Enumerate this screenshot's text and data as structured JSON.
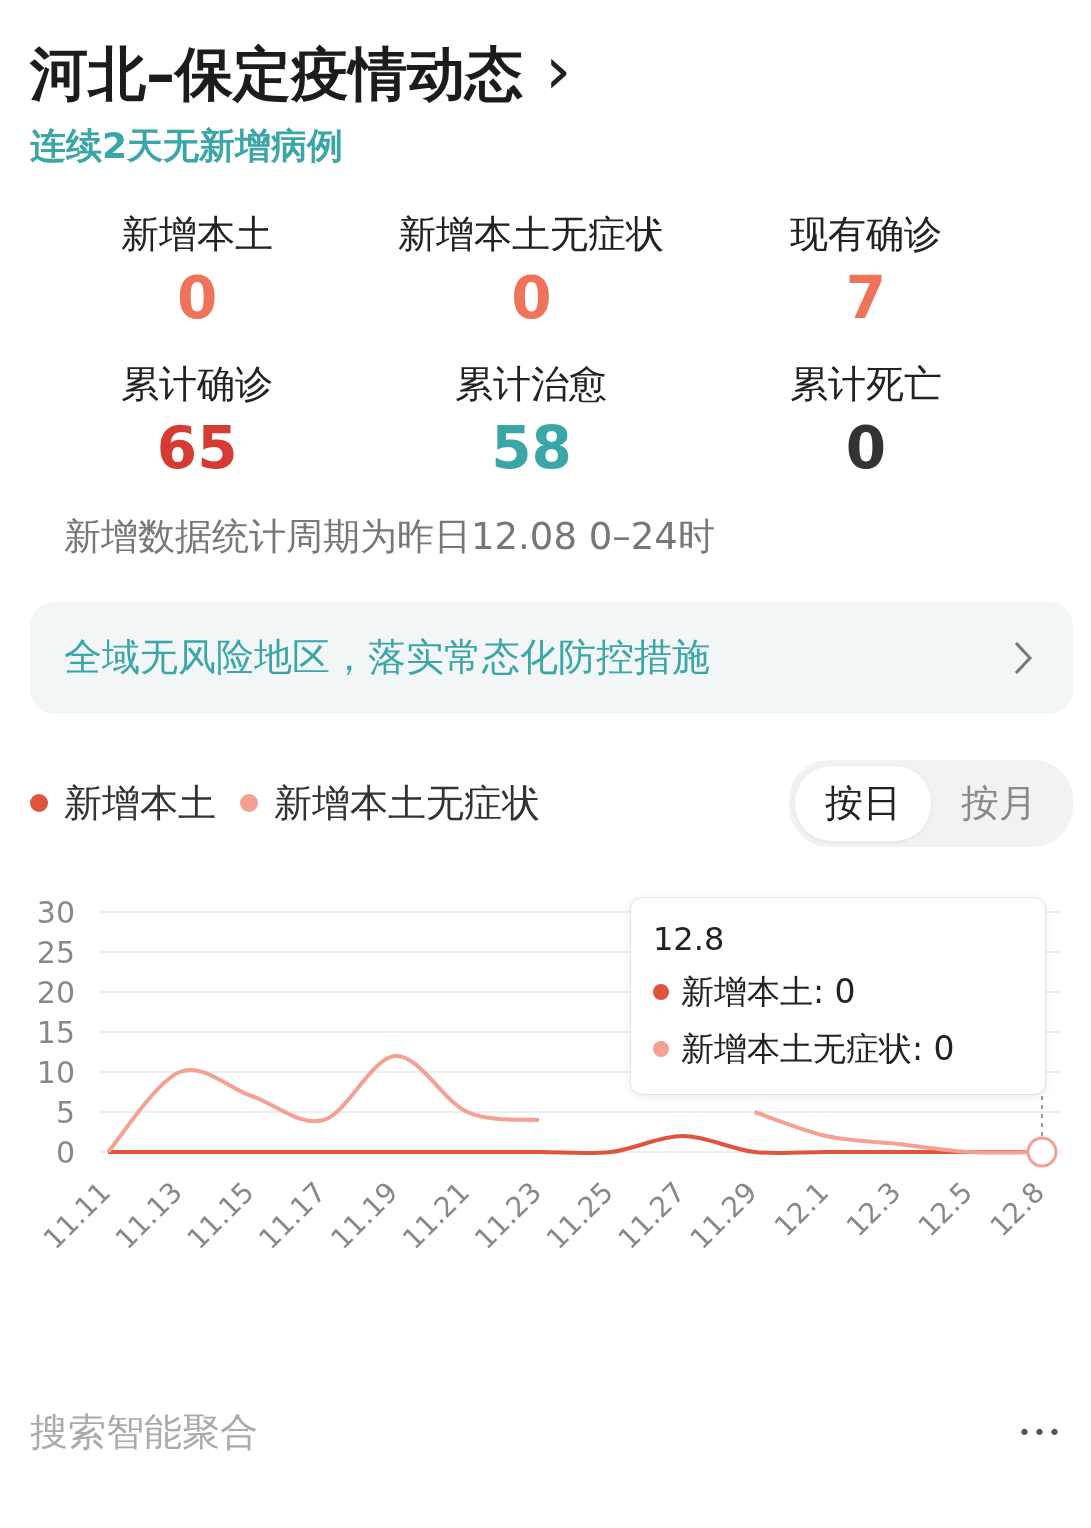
{
  "header": {
    "title": "河北–保定疫情动态",
    "chevron": "›",
    "subtitle": "连续2天无新增病例"
  },
  "stats": [
    {
      "label": "新增本土",
      "value": "0",
      "color": "#ef7358"
    },
    {
      "label": "新增本土无症状",
      "value": "0",
      "color": "#ef7358"
    },
    {
      "label": "现有确诊",
      "value": "7",
      "color": "#ef7358"
    },
    {
      "label": "累计确诊",
      "value": "65",
      "color": "#d63b33"
    },
    {
      "label": "累计治愈",
      "value": "58",
      "color": "#3aa6a8"
    },
    {
      "label": "累计死亡",
      "value": "0",
      "color": "#333333"
    }
  ],
  "note": "新增数据统计周期为昨日12.08 0–24时",
  "banner": {
    "text": "全域无风险地区，落实常态化防控措施"
  },
  "toggle": [
    {
      "label": "按日",
      "selected": true
    },
    {
      "label": "按月",
      "selected": false
    }
  ],
  "chart": {
    "chart_data": {
      "type": "line",
      "categories": [
        "11.11",
        "11.13",
        "11.15",
        "11.17",
        "11.19",
        "11.21",
        "11.23",
        "11.25",
        "11.27",
        "11.29",
        "12.1",
        "12.3",
        "12.5",
        "12.8"
      ],
      "series": [
        {
          "name": "新增本土",
          "color": "#e0533d",
          "values": [
            0,
            0,
            0,
            0,
            0,
            0,
            0,
            0,
            2,
            0,
            0,
            0,
            0,
            0
          ]
        },
        {
          "name": "新增本土无症状",
          "color": "#f4a093",
          "values": [
            0,
            10,
            7,
            4,
            12,
            5,
            4,
            null,
            null,
            5,
            2,
            1,
            0,
            0
          ]
        }
      ],
      "ylim": [
        0,
        30
      ],
      "yticks": [
        0,
        5,
        10,
        15,
        20,
        25,
        30
      ],
      "grid": true,
      "ref_lines": [
        {
          "axis": "x",
          "value": "12.8"
        }
      ]
    },
    "tooltip": {
      "date": "12.8",
      "rows": [
        {
          "text": "新增本土: 0",
          "color": "#e0533d"
        },
        {
          "text": "新增本土无症状: 0",
          "color": "#f4a093"
        }
      ]
    }
  },
  "footer": {
    "text": "搜索智能聚合",
    "more": "•••"
  }
}
